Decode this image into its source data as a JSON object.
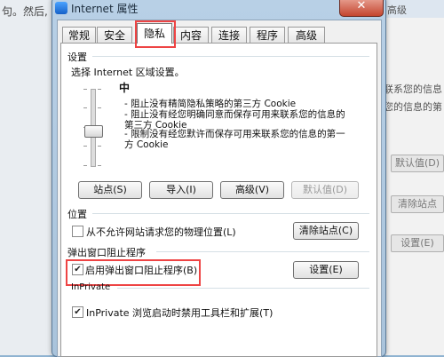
{
  "background": {
    "left_text": "句。然后,",
    "caption_label": "高级",
    "right_text_1": "联系您的信息",
    "right_text_2": "您的信息的第",
    "buttons": [
      "默认值(D)",
      "清除站点",
      "设置(E)"
    ]
  },
  "window": {
    "title": "Internet 属性",
    "close_glyph": "✕"
  },
  "tabs": [
    "常规",
    "安全",
    "隐私",
    "内容",
    "连接",
    "程序",
    "高级"
  ],
  "active_tab": "隐私",
  "settings": {
    "group_label": "设置",
    "zone_prompt": "选择 Internet 区域设置。",
    "level": "中",
    "desc_1": "- 阻止没有精简隐私策略的第三方 Cookie",
    "desc_2": "- 阻止没有经您明确同意而保存可用来联系您的信息的第三方 Cookie",
    "desc_3": "- 限制没有经您默许而保存可用来联系您的信息的第一方 Cookie",
    "buttons": {
      "sites": "站点(S)",
      "import": "导入(I)",
      "advanced": "高级(V)",
      "default": "默认值(D)"
    }
  },
  "location": {
    "group_label": "位置",
    "checkbox_label": "从不允许网站请求您的物理位置(L)",
    "checked": false,
    "clear_button": "清除站点(C)"
  },
  "popup_blocker": {
    "group_label": "弹出窗口阻止程序",
    "checkbox_label": "启用弹出窗口阻止程序(B)",
    "checked": true,
    "settings_button": "设置(E)"
  },
  "inprivate": {
    "group_label": "InPrivate",
    "checkbox_label": "InPrivate 浏览启动时禁用工具栏和扩展(T)",
    "checked": true
  },
  "check_glyph": "✔",
  "highlight_color": "#e44444"
}
